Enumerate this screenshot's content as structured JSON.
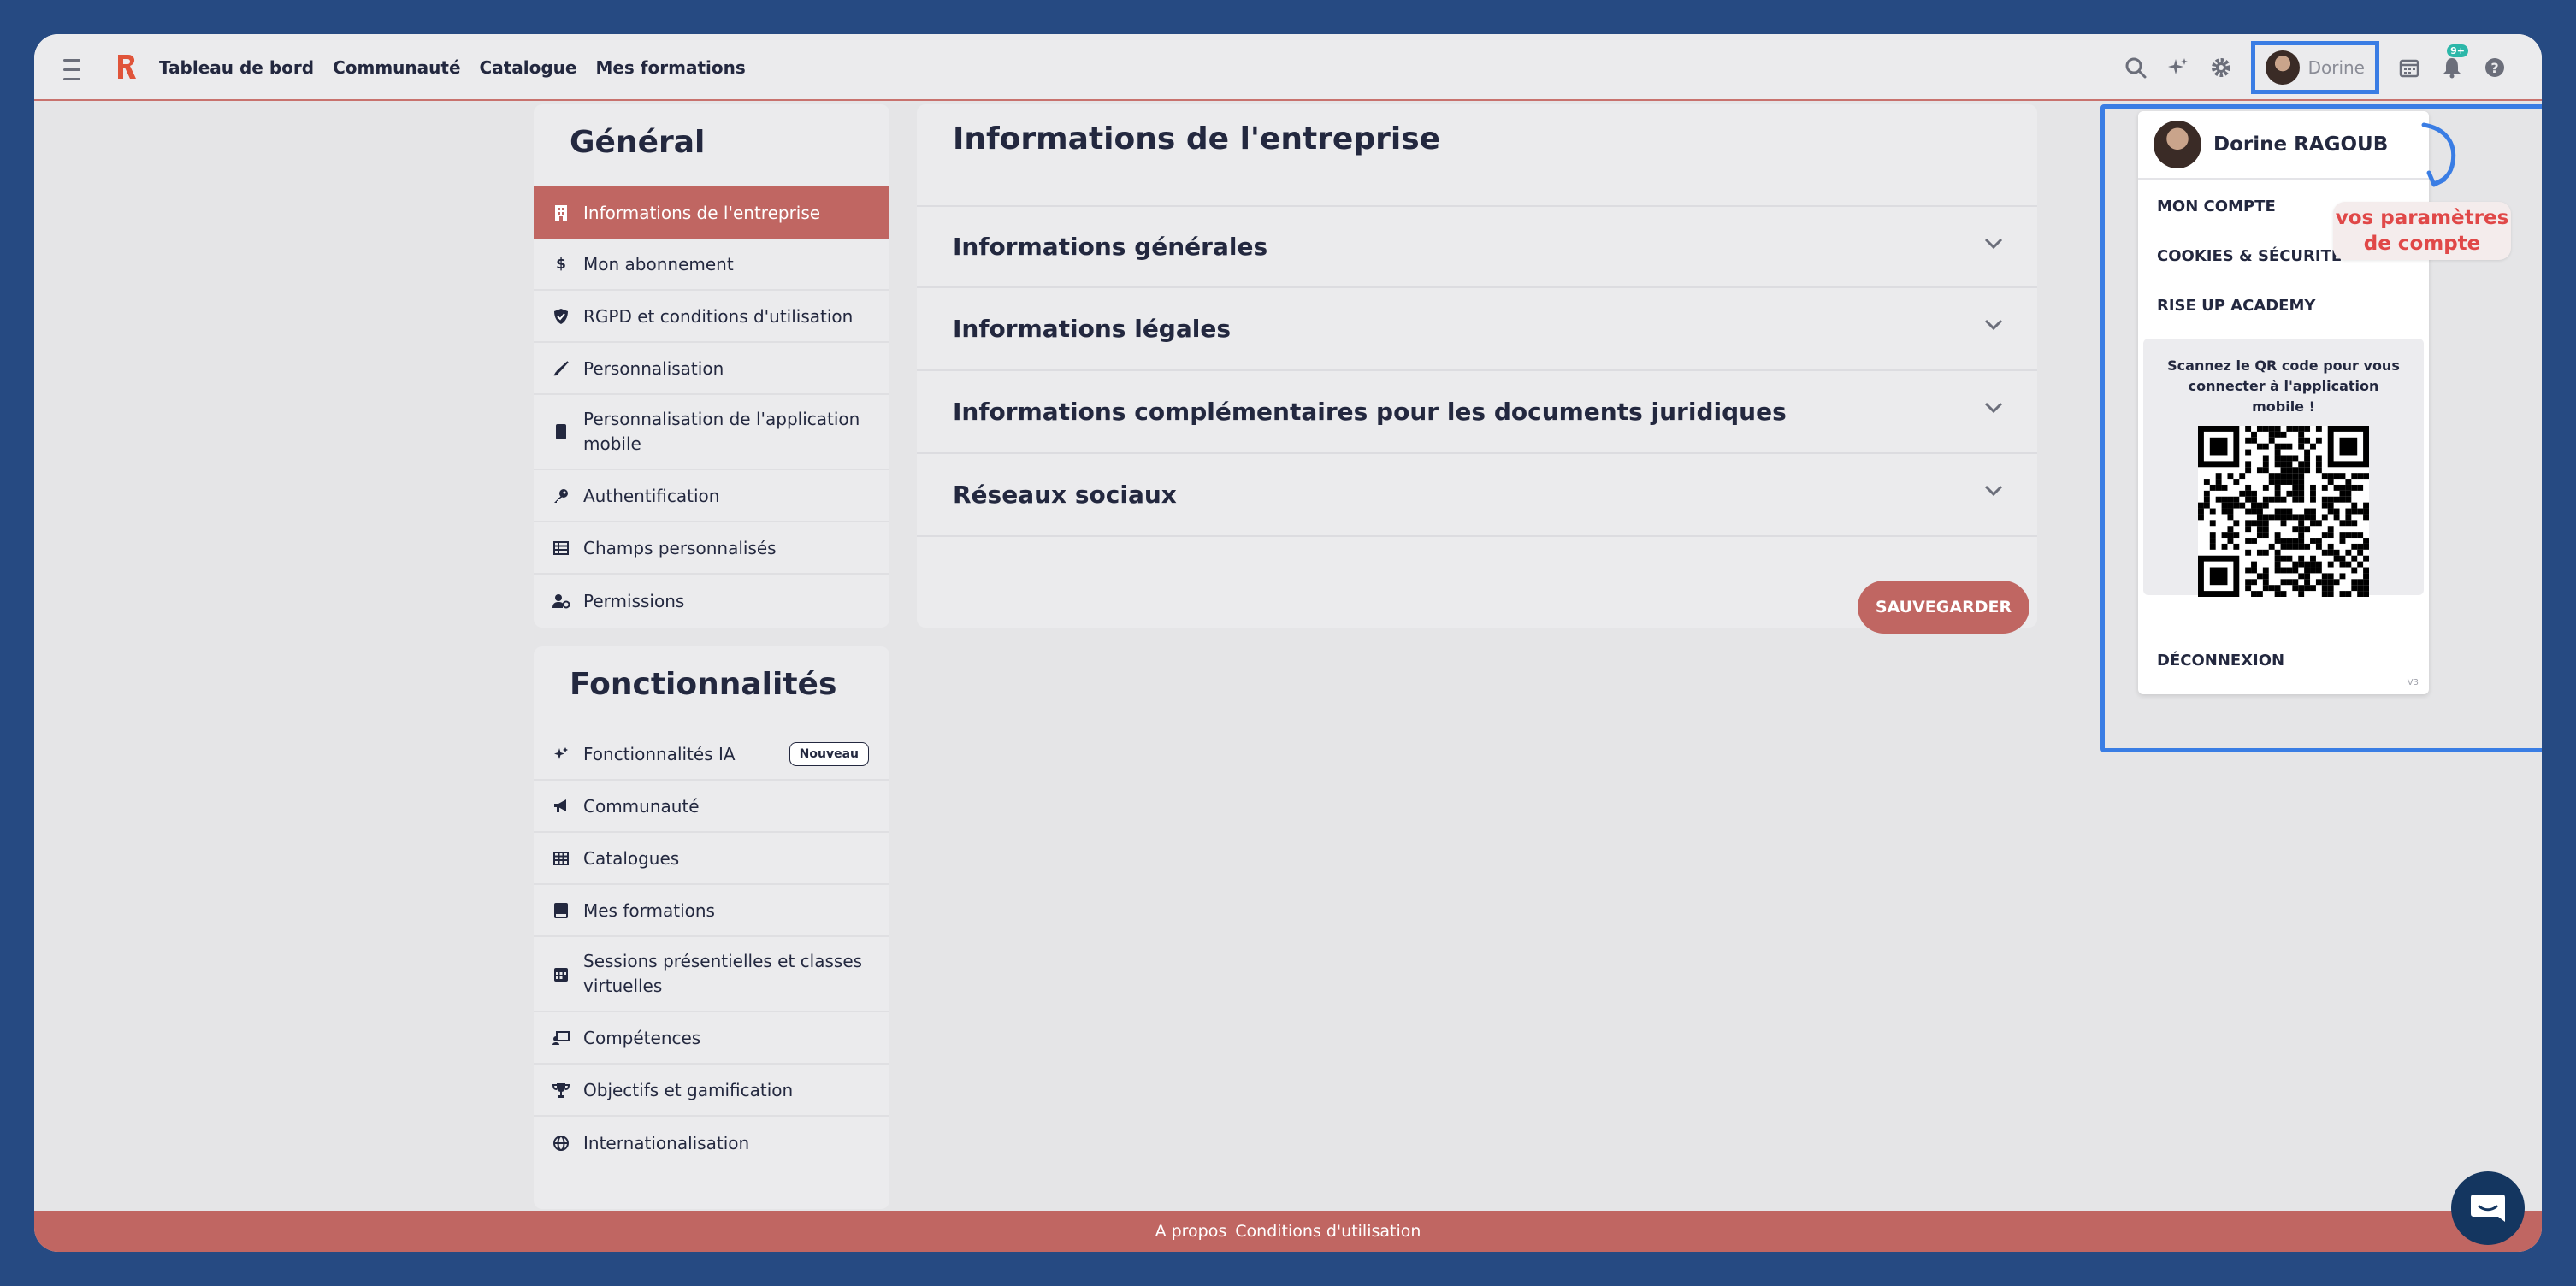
{
  "topbar": {
    "nav": [
      "Tableau de bord",
      "Communauté",
      "Catalogue",
      "Mes formations"
    ],
    "user_name": "Dorine",
    "notif_badge": "9+"
  },
  "general": {
    "title": "Général",
    "items": [
      {
        "label": "Informations de l'entreprise",
        "icon": "building-icon",
        "active": true
      },
      {
        "label": "Mon abonnement",
        "icon": "dollar-icon"
      },
      {
        "label": "RGPD et conditions d'utilisation",
        "icon": "shield-icon"
      },
      {
        "label": "Personnalisation",
        "icon": "brush-icon"
      },
      {
        "label": "Personnalisation de l'application mobile",
        "icon": "mobile-icon"
      },
      {
        "label": "Authentification",
        "icon": "key-icon"
      },
      {
        "label": "Champs personnalisés",
        "icon": "table-icon"
      },
      {
        "label": "Permissions",
        "icon": "user-gear-icon"
      }
    ]
  },
  "features": {
    "title": "Fonctionnalités",
    "new_badge": "Nouveau",
    "items": [
      {
        "label": "Fonctionnalités IA",
        "icon": "sparkles-icon"
      },
      {
        "label": "Communauté",
        "icon": "megaphone-icon"
      },
      {
        "label": "Catalogues",
        "icon": "grid-icon"
      },
      {
        "label": "Mes formations",
        "icon": "book-icon"
      },
      {
        "label": "Sessions présentielles et classes virtuelles",
        "icon": "calendar-icon"
      },
      {
        "label": "Compétences",
        "icon": "teacher-icon"
      },
      {
        "label": "Objectifs et gamification",
        "icon": "trophy-icon"
      },
      {
        "label": "Internationalisation",
        "icon": "globe-icon"
      }
    ]
  },
  "main": {
    "title": "Informations de l'entreprise",
    "sections": [
      "Informations générales",
      "Informations légales",
      "Informations complémentaires pour les documents juridiques",
      "Réseaux sociaux"
    ],
    "save_label": "SAUVEGARDER"
  },
  "dropdown": {
    "full_name": "Dorine RAGOUB",
    "items": [
      "MON COMPTE",
      "COOKIES & SÉCURITÉ",
      "RISE UP ACADEMY"
    ],
    "qr_text": "Scannez le QR code pour vous connecter à l'application mobile !",
    "logout": "DÉCONNEXION",
    "version": "V3"
  },
  "annotation": {
    "text_line1": "vos paramètres",
    "text_line2": "de compte",
    "color": "#e04848",
    "frame_color": "#3a7de4"
  },
  "footer": {
    "links": [
      "A propos",
      "Conditions d'utilisation"
    ]
  },
  "colors": {
    "accent": "#c06662",
    "navy": "#23283f",
    "background": "#264a82"
  }
}
